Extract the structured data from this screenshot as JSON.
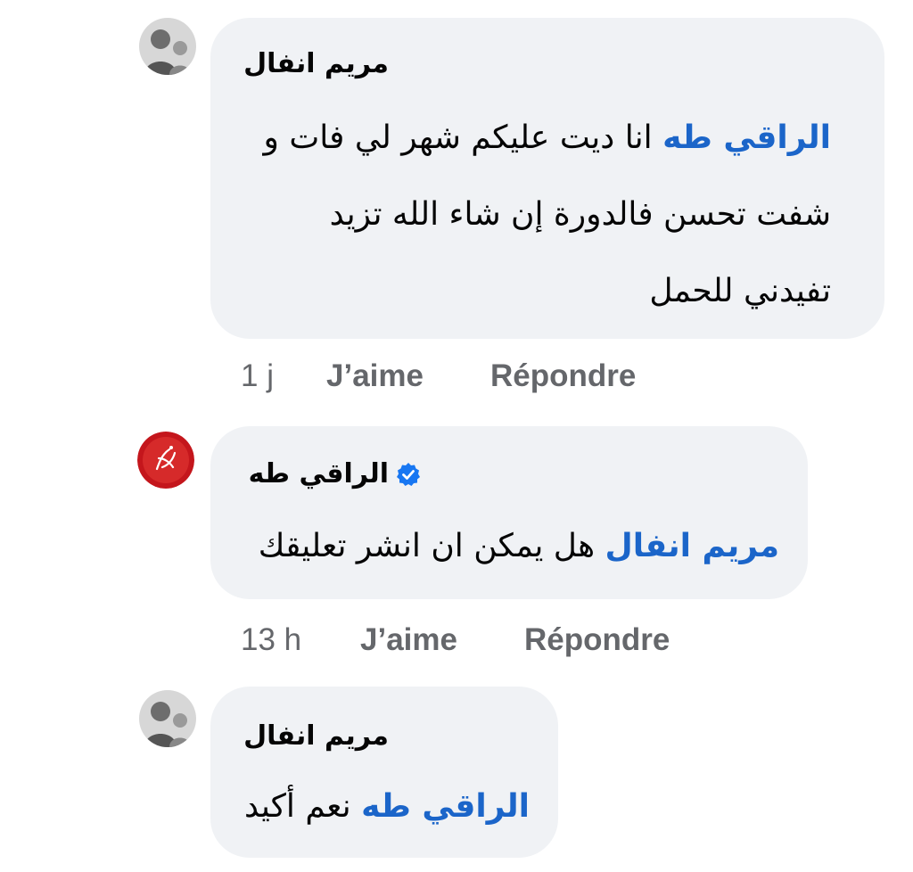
{
  "comments": [
    {
      "author": "مريم انفال",
      "mention": "الراقي طه",
      "text_line1": "انا ديت عليكم شهر لي فات و",
      "text_line2": "شفت تحسن فالدورة إن شاء الله تزيد",
      "text_line3": "تفيدني للحمل",
      "time": "1 j",
      "like_label": "J’aime",
      "reply_label": "Répondre",
      "avatar_icon": "profile-photo-icon"
    },
    {
      "author": "الراقي طه",
      "verified_icon": "verified-badge-icon",
      "verified_color": "#1877f2",
      "mention": "مريم انفال",
      "text_line1": "هل يمكن ان انشر تعليقك",
      "time": "13 h",
      "like_label": "J’aime",
      "reply_label": "Répondre",
      "avatar_icon": "red-calligraphy-logo-icon"
    },
    {
      "author": "مريم انفال",
      "mention": "الراقي طه",
      "text_line1": "نعم أكيد",
      "avatar_icon": "profile-photo-icon"
    }
  ],
  "colors": {
    "bubble": "#f0f2f5",
    "mention": "#1b65c9",
    "meta": "#65676b"
  }
}
